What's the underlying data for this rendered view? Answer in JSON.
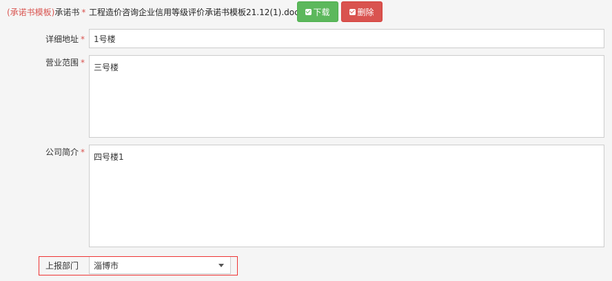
{
  "commitment": {
    "template_link": "(承诺书模板)",
    "label": "承诺书",
    "required_mark": "*",
    "file_name": "工程造价咨询企业信用等级评价承诺书模板21.12(1).doc",
    "download_label": "下载",
    "delete_label": "删除"
  },
  "address": {
    "label": "详细地址",
    "required_mark": "*",
    "value": "1号楼"
  },
  "business_scope": {
    "label": "营业范围",
    "required_mark": "*",
    "value": "三号楼"
  },
  "company_intro": {
    "label": "公司简介",
    "required_mark": "*",
    "value": "四号楼1"
  },
  "report_dept": {
    "label": "上报部门",
    "selected": "淄博市"
  },
  "colors": {
    "download_button": "#5cb85c",
    "delete_button": "#d9534f",
    "required": "#d9534f",
    "highlight_border": "#ee3333"
  },
  "icons": {
    "download": "check-square-icon",
    "delete": "check-square-icon",
    "select": "chevron-down-icon"
  }
}
